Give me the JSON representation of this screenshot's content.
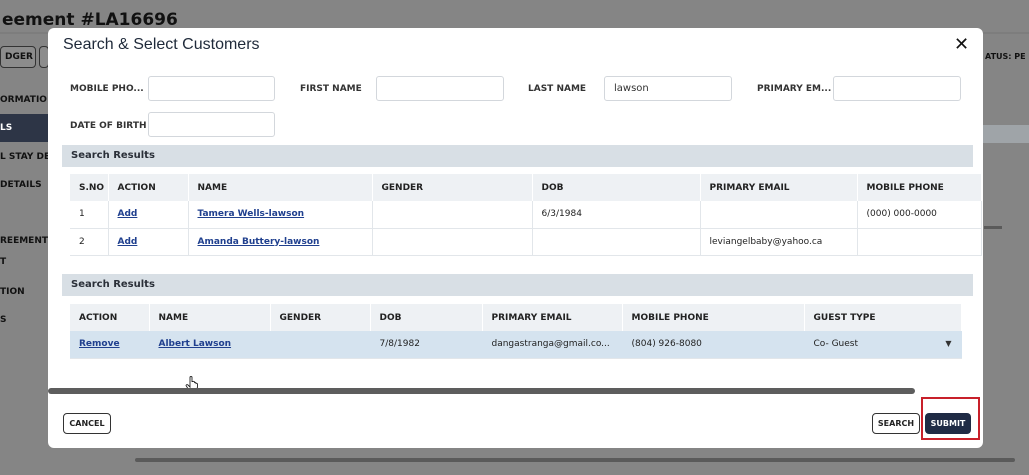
{
  "background": {
    "title": "eement #LA16696",
    "buttons": [
      "DGER",
      ""
    ],
    "status_text": "ATUS: PE",
    "sidebar": [
      "ORMATIO",
      "LS",
      "L STAY DE",
      "DETAILS",
      "REEMENT",
      "T",
      "TION",
      "S"
    ]
  },
  "modal": {
    "title": "Search & Select Customers",
    "close_icon": "close-icon",
    "fields": {
      "mobile_phone": {
        "label": "MOBILE PHO...",
        "value": ""
      },
      "first_name": {
        "label": "FIRST NAME",
        "value": ""
      },
      "last_name": {
        "label": "LAST NAME",
        "value": "lawson"
      },
      "primary_email": {
        "label": "PRIMARY EM...",
        "value": ""
      },
      "date_of_birth": {
        "label": "DATE OF BIRTH",
        "value": ""
      }
    },
    "results_section": {
      "title": "Search Results",
      "columns": [
        "S.NO",
        "ACTION",
        "NAME",
        "GENDER",
        "DOB",
        "PRIMARY EMAIL",
        "MOBILE PHONE"
      ],
      "rows": [
        {
          "sno": "1",
          "action": "Add",
          "name": "Tamera Wells-lawson",
          "gender": "",
          "dob": "6/3/1984",
          "email": "",
          "phone": "(000) 000-0000"
        },
        {
          "sno": "2",
          "action": "Add",
          "name": "Amanda Buttery-lawson",
          "gender": "",
          "dob": "",
          "email": "leviangelbaby@yahoo.ca",
          "phone": ""
        }
      ]
    },
    "selected_section": {
      "title": "Search Results",
      "columns": [
        "ACTION",
        "NAME",
        "GENDER",
        "DOB",
        "PRIMARY EMAIL",
        "MOBILE PHONE",
        "GUEST TYPE"
      ],
      "rows": [
        {
          "action": "Remove",
          "name": "Albert Lawson",
          "gender": "",
          "dob": "7/8/1982",
          "email": "dangastranga@gmail.co...",
          "phone": "(804) 926-8080",
          "guest_type": "Co- Guest"
        }
      ]
    },
    "buttons": {
      "cancel": "CANCEL",
      "search": "SEARCH",
      "submit": "SUBMIT"
    }
  },
  "colors": {
    "submit_bg": "#1f2b45",
    "section_header_bg": "#d8dfe5",
    "link": "#1f3f8e",
    "selected_row_bg": "#d5e3ef",
    "highlight_border": "#c8202a"
  }
}
